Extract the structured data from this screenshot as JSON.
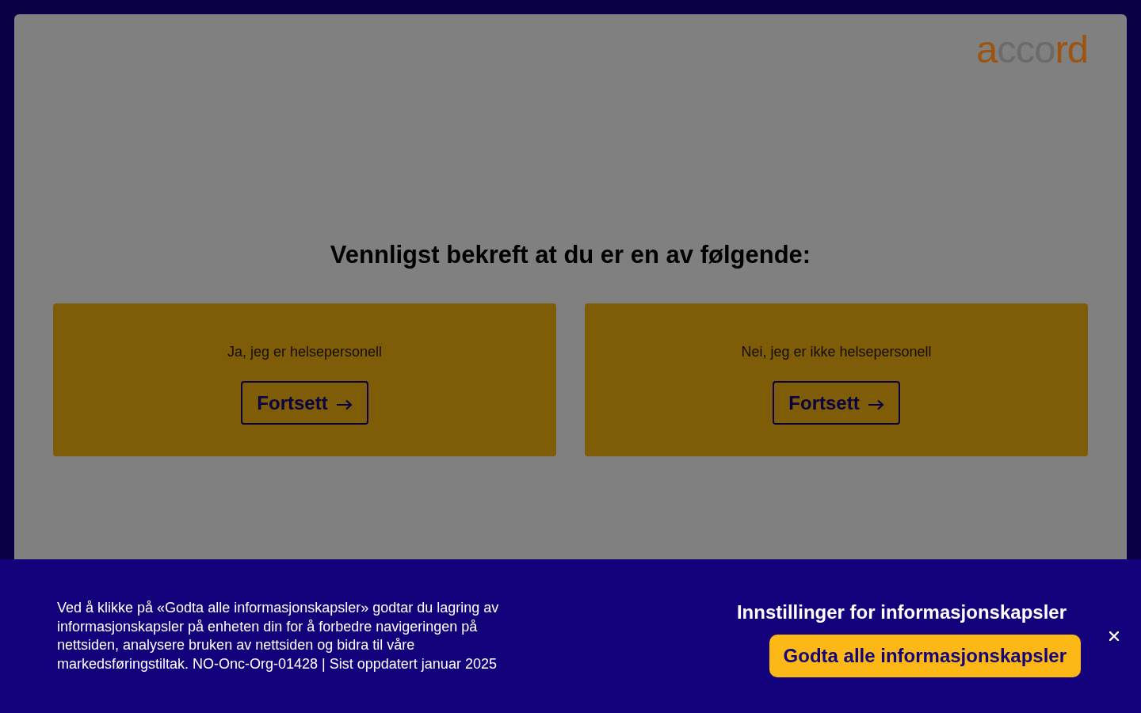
{
  "logo": {
    "parts": [
      {
        "text": "a",
        "color": "#9c5410"
      },
      {
        "text": "cco",
        "color": "#6b6b6b"
      },
      {
        "text": "rd",
        "color": "#9c5410"
      }
    ]
  },
  "heading": "Vennligst bekreft at du er en av følgende:",
  "options": [
    {
      "label": "Ja, jeg er helsepersonell",
      "button": "Fortsett"
    },
    {
      "label": "Nei, jeg er ikke helsepersonell",
      "button": "Fortsett"
    }
  ],
  "cookie_banner": {
    "text": "Ved å klikke på «Godta alle informasjonskapsler» godtar du lagring av informasjonskapsler på enheten din for å forbedre navigeringen på nettsiden, analysere bruken av nettsiden og bidra til våre markedsføringstiltak. NO-Onc-Org-01428 | Sist oppdatert januar 2025",
    "settings_link": "Innstillinger for informasjonskapsler",
    "accept_button": "Godta alle informasjonskapsler"
  }
}
